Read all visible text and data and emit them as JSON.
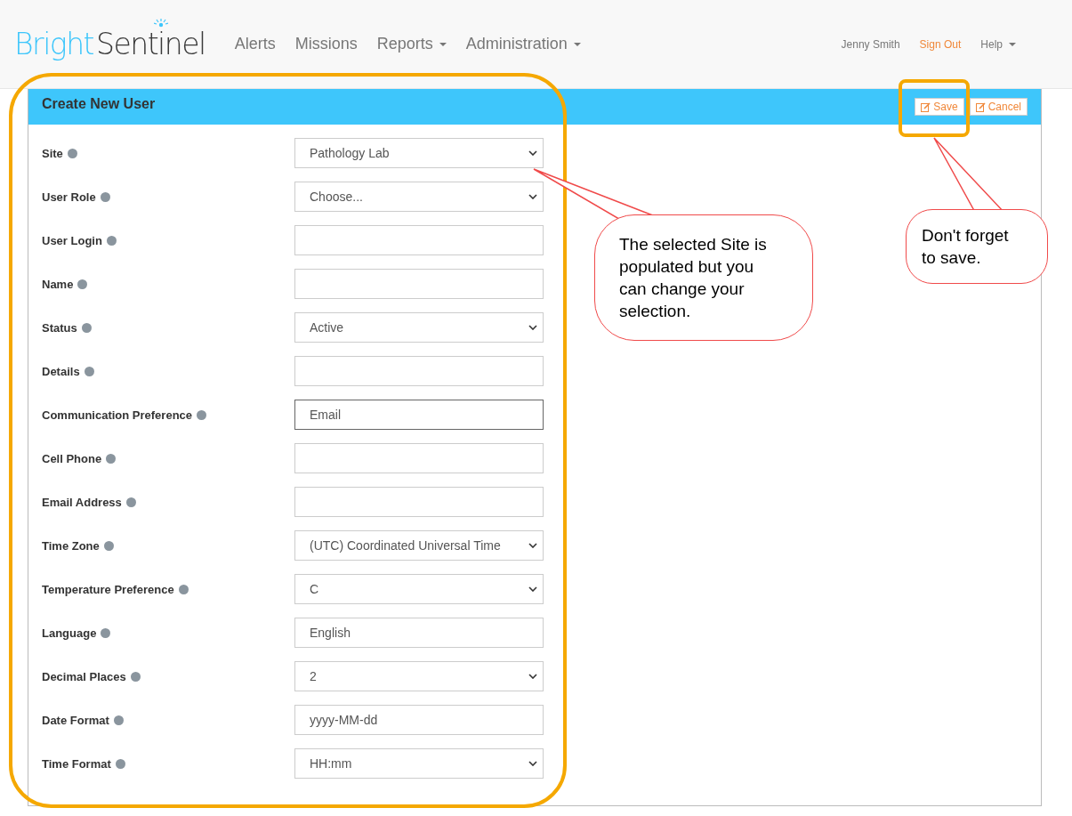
{
  "brand": {
    "first": "Bright",
    "second": "Sentinel"
  },
  "nav": [
    {
      "label": "Alerts",
      "dropdown": false
    },
    {
      "label": "Missions",
      "dropdown": false
    },
    {
      "label": "Reports",
      "dropdown": true
    },
    {
      "label": "Administration",
      "dropdown": true
    }
  ],
  "user_nav": [
    {
      "kind": "user",
      "label": "Jenny Smith",
      "dropdown": false
    },
    {
      "kind": "signout",
      "label": "Sign Out",
      "dropdown": false
    },
    {
      "kind": "menu",
      "label": "Help",
      "dropdown": true
    }
  ],
  "panel": {
    "title": "Create New User",
    "buttons": [
      {
        "label": "Save"
      },
      {
        "label": "Cancel"
      }
    ]
  },
  "fields": [
    {
      "label": "Site",
      "kind": "select",
      "value": "Pathology Lab",
      "focused": false
    },
    {
      "label": "User Role",
      "kind": "select",
      "value": "Choose...",
      "focused": false
    },
    {
      "label": "User Login",
      "kind": "text",
      "focused": false
    },
    {
      "label": "Name",
      "kind": "text",
      "focused": false
    },
    {
      "label": "Status",
      "kind": "select",
      "value": "Active",
      "focused": false
    },
    {
      "label": "Details",
      "kind": "text",
      "focused": false
    },
    {
      "label": "Communication Preference",
      "kind": "text",
      "value": "Email",
      "focused": true
    },
    {
      "label": "Cell Phone",
      "kind": "text",
      "focused": false
    },
    {
      "label": "Email Address",
      "kind": "text",
      "focused": false
    },
    {
      "label": "Time Zone",
      "kind": "select",
      "value": "(UTC) Coordinated Universal Time",
      "focused": false
    },
    {
      "label": "Temperature Preference",
      "kind": "select",
      "value": "C",
      "focused": false
    },
    {
      "label": "Language",
      "kind": "text",
      "value": "English",
      "focused": false
    },
    {
      "label": "Decimal Places",
      "kind": "select",
      "value": "2",
      "focused": false
    },
    {
      "label": "Date Format",
      "kind": "text",
      "value": "yyyy-MM-dd",
      "focused": false
    },
    {
      "label": "Time Format",
      "kind": "select",
      "value": "HH:mm",
      "focused": false
    }
  ],
  "callouts": [
    {
      "text": "The selected Site is populated but you can change your selection."
    },
    {
      "text": "Don't forget to save."
    }
  ]
}
